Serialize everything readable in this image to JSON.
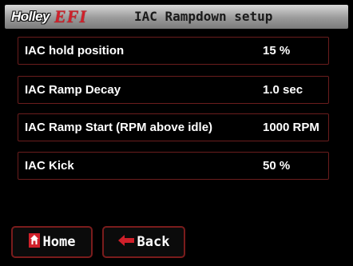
{
  "header": {
    "logo_text": "Holley",
    "logo_efi": "EFI",
    "title": "IAC Rampdown setup"
  },
  "settings": [
    {
      "label": "IAC hold position",
      "value": "15 %"
    },
    {
      "label": "IAC Ramp Decay",
      "value": "1.0 sec"
    },
    {
      "label": "IAC Ramp Start (RPM above idle)",
      "value": "1000 RPM"
    },
    {
      "label": "IAC Kick",
      "value": "50 %"
    }
  ],
  "footer": {
    "home_label": "Home",
    "back_label": "Back"
  },
  "colors": {
    "accent_red": "#d0202a",
    "row_border": "#6a1d1d",
    "header_gray": "#9a9a9a"
  },
  "icons": {
    "home": "home-icon",
    "back": "left-arrow-icon"
  }
}
